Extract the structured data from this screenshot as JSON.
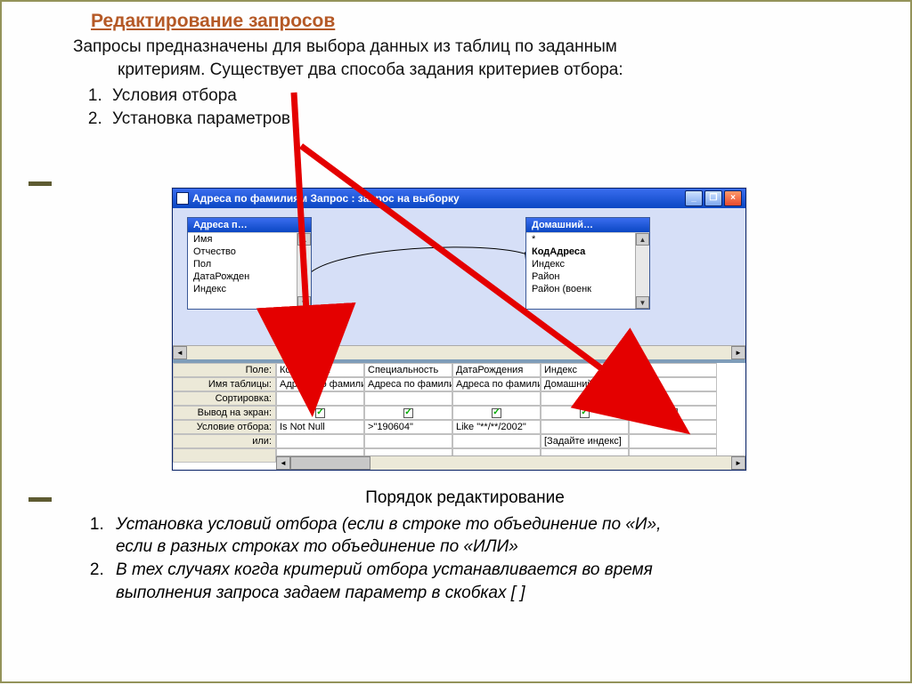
{
  "title": "Редактирование запросов",
  "intro": {
    "line1": "Запросы предназначены для выбора данных из таблиц по заданным",
    "line2": "критериям. Существует два способа задания критериев отбора:",
    "item1": "Условия отбора",
    "item2": "Установка параметров"
  },
  "window": {
    "title": "Адреса по фамилиям Запрос : запрос на выборку",
    "table_left": {
      "title": "Адреса п…",
      "fields": [
        "Имя",
        "Отчество",
        "Пол",
        "ДатаРожден",
        "Индекс"
      ]
    },
    "table_right": {
      "title": "Домашний…",
      "fields": [
        "*",
        "КодАдреса",
        "Индекс",
        "Район",
        "Район (военк"
      ]
    },
    "grid": {
      "row_labels": [
        "Поле:",
        "Имя таблицы:",
        "Сортировка:",
        "Вывод на экран:",
        "Условие отбора:",
        "или:"
      ],
      "columns": [
        {
          "field": "КодАдреса",
          "table": "Адреса по фамили",
          "sort": "",
          "show": true,
          "criteria": "Is Not Null",
          "or": ""
        },
        {
          "field": "Специальность",
          "table": "Адреса по фамили",
          "sort": "",
          "show": true,
          "criteria": ">\"190604\"",
          "or": ""
        },
        {
          "field": "ДатаРождения",
          "table": "Адреса по фамили",
          "sort": "",
          "show": true,
          "criteria": "Like \"**/**/2002\"",
          "or": ""
        },
        {
          "field": "Индекс",
          "table": "Домашний адрес",
          "sort": "",
          "show": true,
          "criteria": "",
          "or": "[Задайте индекс]"
        },
        {
          "field": "Рай",
          "table": "Дом",
          "sort": "",
          "show": false,
          "criteria": "",
          "or": ""
        }
      ]
    }
  },
  "bottom": {
    "subtitle": "Порядок редактирование",
    "item1a": " Установка условий отбора (если в строке то объединение по «И»,",
    "item1b": "если в разных строках то объединение по «ИЛИ»",
    "item2a": "В тех случаях когда критерий отбора устанавливается во время",
    "item2b": "выполнения запроса задаем параметр в скобках [ ]"
  }
}
